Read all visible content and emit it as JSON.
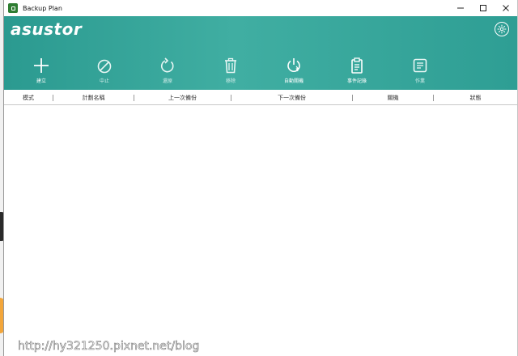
{
  "window": {
    "title": "Backup Plan",
    "minimize_symbol": "—",
    "maximize_symbol": "☐",
    "close_symbol": "✕"
  },
  "banner": {
    "logo": "asustor",
    "settings_icon": "gear-icon",
    "accent_color": "#36a397"
  },
  "toolbar": {
    "create": {
      "label": "建立",
      "icon": "plus-icon"
    },
    "stop": {
      "label": "中止",
      "icon": "stop-icon"
    },
    "restore": {
      "label": "還原",
      "icon": "restore-icon"
    },
    "remove": {
      "label": "移除",
      "icon": "trash-icon"
    },
    "auto_shutdown": {
      "label": "自動關機",
      "icon": "power-icon"
    },
    "event_log": {
      "label": "事件記錄",
      "icon": "clipboard-icon"
    },
    "jobs": {
      "label": "作業",
      "icon": "list-icon"
    }
  },
  "table": {
    "columns": [
      "模式",
      "計劃名稱",
      "上一次備份",
      "下一次備份",
      "關機",
      "狀態"
    ]
  },
  "watermark": "http://hy321250.pixnet.net/blog"
}
